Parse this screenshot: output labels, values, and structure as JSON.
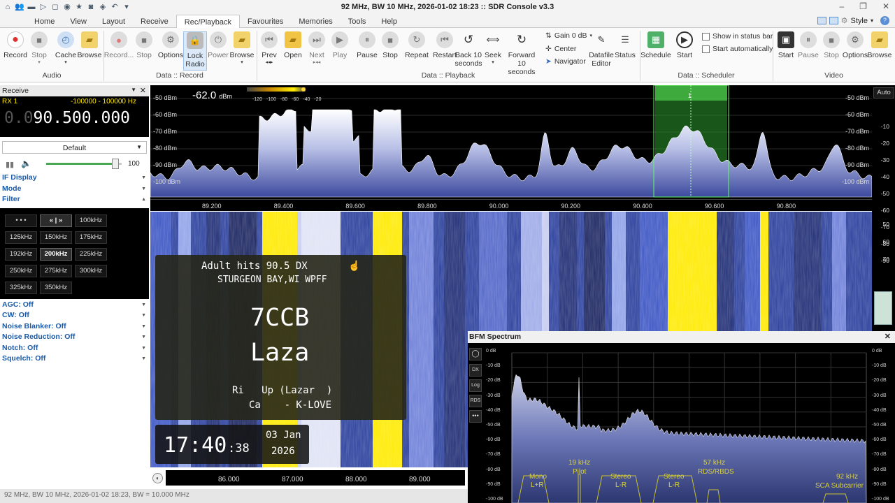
{
  "window": {
    "title": "92 MHz, BW 10 MHz, 2026-01-02 18:23 :: SDR Console v3.3"
  },
  "menu": {
    "tabs": [
      "Home",
      "View",
      "Layout",
      "Receive",
      "Rec/Playback",
      "Favourites",
      "Memories",
      "Tools",
      "Help"
    ],
    "active": "Rec/Playback",
    "style_label": "Style"
  },
  "ribbon": {
    "audio": {
      "group": "Audio",
      "record": "Record",
      "stop": "Stop",
      "cache": "Cache",
      "browse": "Browse"
    },
    "record": {
      "group": "Data :: Record",
      "record": "Record...",
      "stop": "Stop",
      "options": "Options",
      "lock": "Lock",
      "radio": "Radio",
      "power": "Power",
      "browse": "Browse"
    },
    "playback": {
      "group": "Data :: Playback",
      "prev": "Prev",
      "open": "Open",
      "next": "Next",
      "play": "Play",
      "pause": "Pause",
      "stop": "Stop",
      "repeat": "Repeat",
      "restart": "Restart",
      "back": "Back 10",
      "back2": "seconds",
      "seek": "Seek",
      "fwd": "Forward 10",
      "fwd2": "seconds",
      "gain": "Gain 0 dB",
      "center": "Center",
      "navigator": "Navigator",
      "datafile": "Datafile",
      "editor": "Editor",
      "status": "Status"
    },
    "scheduler": {
      "group": "Data :: Scheduler",
      "schedule": "Schedule",
      "start": "Start",
      "show_status": "Show in status bar",
      "start_auto": "Start automatically"
    },
    "video": {
      "group": "Video",
      "start": "Start",
      "pause": "Pause",
      "stop": "Stop",
      "options": "Options",
      "browse": "Browse"
    }
  },
  "receive": {
    "panel_title": "Receive",
    "rx": "RX 1",
    "range": "-100000 - 100000 Hz",
    "freq_lead": "0.0",
    "freq_main": "90.500.000",
    "preset": "Default",
    "volume": "100",
    "volume_level": 0.92,
    "if_display": "IF Display",
    "mode": "Mode",
    "filter": "Filter",
    "filters": [
      "• • •",
      "« | »",
      "100kHz",
      "125kHz",
      "150kHz",
      "175kHz",
      "192kHz",
      "200kHz",
      "225kHz",
      "250kHz",
      "275kHz",
      "300kHz",
      "325kHz",
      "350kHz"
    ],
    "filter_selected": "200kHz",
    "options": [
      "AGC: Off",
      "CW: Off",
      "Noise Blanker: Off",
      "Noise Reduction: Off",
      "Notch: Off",
      "Squelch: Off"
    ]
  },
  "spectrum": {
    "level": "-62.0",
    "level_unit": "dBm",
    "meter_ticks": [
      "-120",
      "-100",
      "-80",
      "-60",
      "-40",
      "-20"
    ],
    "db_labels": [
      "-50 dBm",
      "-60 dBm",
      "-70 dBm",
      "-80 dBm",
      "-90 dBm",
      "-100 dBm"
    ],
    "freq_labels": [
      "89.200",
      "89.400",
      "89.600",
      "89.800",
      "90.000",
      "90.200",
      "90.400",
      "90.600",
      "90.800"
    ],
    "vfo_marker": "1",
    "auto": "Auto",
    "scale_right": [
      "-10",
      "-20",
      "-30",
      "-40",
      "-50",
      "-60",
      "-70",
      "-80",
      "-90"
    ],
    "scale_right_lower": [
      "50",
      "60",
      "70"
    ]
  },
  "waterfall": {
    "freq_labels": [
      "86.000",
      "87.000",
      "88.000",
      "89.000"
    ]
  },
  "rds": {
    "line1": "Adult hits   90.5   DX",
    "line2": "STURGEON BAY,WI   WPFF",
    "ps1": "7CCB",
    "ps2": "Laza",
    "rt1": "Ri   Up (Lazar  )",
    "rt2": "Ca    - K-LOVE",
    "time_hm": "17:40",
    "time_s": ":38",
    "date": "03 Jan",
    "year": "2026"
  },
  "bfm": {
    "title": "BFM Spectrum",
    "side_buttons": [
      "DX",
      "Log",
      "RDS"
    ],
    "db_labels": [
      "0 dB",
      "-10 dB",
      "-20 dB",
      "-30 dB",
      "-40 dB",
      "-50 dB",
      "-60 dB",
      "-70 dB",
      "-80 dB",
      "-90 dB",
      "-100 dB"
    ],
    "bands": {
      "mono": "Mono",
      "lr": "L+R",
      "pilot_freq": "19 kHz",
      "pilot": "Pilot",
      "stereo": "Stereo",
      "lmr": "L-R",
      "rds_freq": "57 kHz",
      "rds": "RDS/RBDS",
      "sca_freq": "92 kHz",
      "sca": "SCA Subcarrier"
    }
  },
  "status": {
    "text": "92 MHz, BW 10 MHz, 2026-01-02 18:23, BW = 10.000 MHz"
  },
  "colors": {
    "accent": "#1a5aa8",
    "yellow": "#ffea00",
    "spectrum_fill": "#6b79c8",
    "waterfall_blue": "#2a3f9c"
  }
}
